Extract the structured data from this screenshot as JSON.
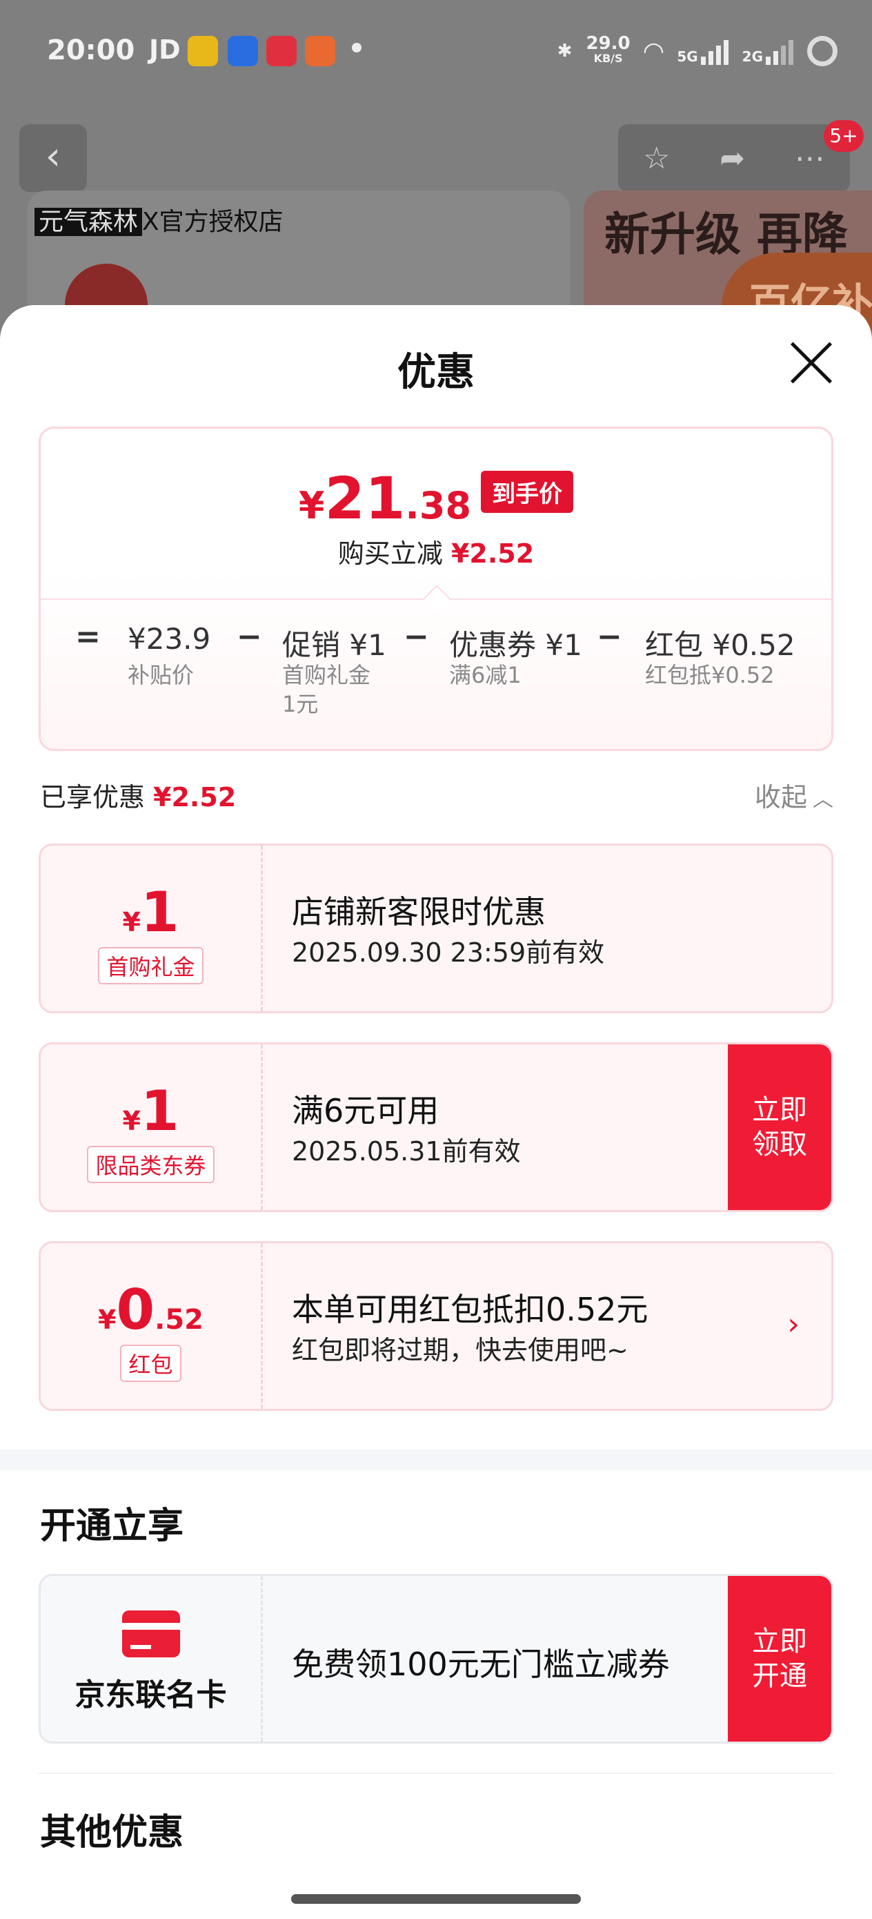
{
  "status_bar": {
    "time": "20:00",
    "carrier_label": "JD",
    "speed_value": "29.0",
    "speed_unit": "KB/S",
    "sim1": "5G",
    "sim2": "2G"
  },
  "background_page": {
    "notification_badge": "5+",
    "shop_tag": "元气森林",
    "shop_name": "X官方授权店",
    "promo_text": "新升级 再降",
    "promo_corner": "百亿补贴"
  },
  "sheet": {
    "title": "优惠",
    "price": {
      "yen": "¥",
      "integer": "21",
      "decimal": ".38",
      "tag": "到手价",
      "save_label": "购买立减",
      "save_amount": "¥2.52"
    },
    "breakdown": [
      {
        "op": "=",
        "value": "¥23.9",
        "sub": "补贴价"
      },
      {
        "op": "−",
        "value": "促销 ¥1",
        "sub": "首购礼金\n1元"
      },
      {
        "op": "−",
        "value": "优惠券 ¥1",
        "sub": "满6减1"
      },
      {
        "op": "−",
        "value": "红包 ¥0.52",
        "sub": "红包抵¥0.52"
      }
    ],
    "enjoyed": {
      "label": "已享优惠",
      "amount": "¥2.52",
      "collapse": "收起",
      "collapse_icon": "chevron-up-icon"
    },
    "coupons": [
      {
        "yen": "¥",
        "num": "1",
        "dec": "",
        "kind": "首购礼金",
        "title": "店铺新客限时优惠",
        "detail": "2025.09.30 23:59前有效",
        "action": ""
      },
      {
        "yen": "¥",
        "num": "1",
        "dec": "",
        "kind": "限品类东券",
        "title": "满6元可用",
        "detail": "2025.05.31前有效",
        "action": "立即\n领取"
      },
      {
        "yen": "¥",
        "num": "0",
        "dec": ".52",
        "kind": "红包",
        "title": "本单可用红包抵扣0.52元",
        "detail": "红包即将过期，快去使用吧~",
        "action": ""
      }
    ],
    "open_section": {
      "title": "开通立享",
      "card_name": "京东联名卡",
      "desc": "免费领100元无门槛立减券",
      "action": "立即\n开通"
    },
    "other_section": {
      "title": "其他优惠"
    }
  },
  "colors": {
    "accent": "#e2132f",
    "action_bg": "#f01c35",
    "coupon_bg": "#fff5f6"
  }
}
